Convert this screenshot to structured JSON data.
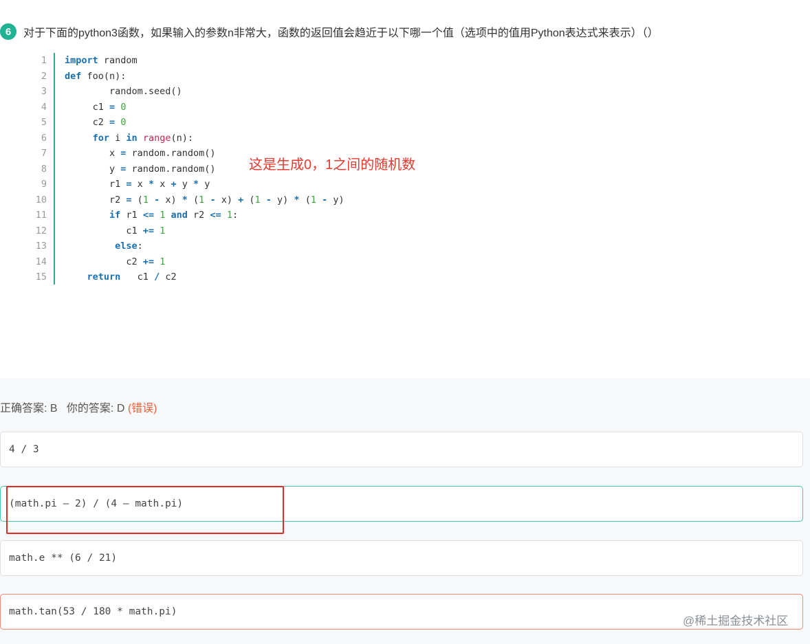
{
  "question": {
    "number": "6",
    "text": "对于下面的python3函数，如果输入的参数n非常大，函数的返回值会趋近于以下哪一个值（选项中的值用Python表达式来表示）（）"
  },
  "code": {
    "line_numbers": [
      "1",
      "2",
      "3",
      "4",
      "5",
      "6",
      "7",
      "8",
      "9",
      "10",
      "11",
      "12",
      "13",
      "14",
      "15"
    ]
  },
  "annotation": "这是生成0，1之间的随机数",
  "result": {
    "correct_label": "正确答案: B",
    "your_label": "你的答案: D",
    "status": "(错误)"
  },
  "options": [
    {
      "text": "4 / 3",
      "state": "normal"
    },
    {
      "text": "(math.pi – 2) / (4 – math.pi)",
      "state": "correct"
    },
    {
      "text": "math.e ** (6 / 21)",
      "state": "normal"
    },
    {
      "text": "math.tan(53 / 180 * math.pi)",
      "state": "wrong"
    }
  ],
  "watermark": "@稀土掘金技术社区",
  "colors": {
    "accent": "#1fb394",
    "annotation": "#e53a2c",
    "wrong": "#e8623c",
    "highlight_box": "#e12b2b"
  }
}
